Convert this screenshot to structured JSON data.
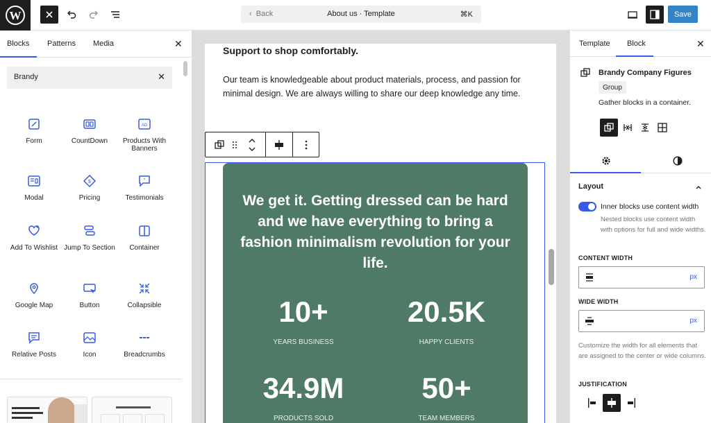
{
  "topbar": {
    "wp_logo_icon": "wordpress-logo",
    "back_label": "Back",
    "doc_title": "About us · Template",
    "shortcut": "⌘K",
    "save_label": "Save"
  },
  "inserter": {
    "tabs": [
      "Blocks",
      "Patterns",
      "Media"
    ],
    "active_tab": "Blocks",
    "search_value": "Brandy",
    "blocks": [
      {
        "label": "Form",
        "icon": "form-icon"
      },
      {
        "label": "CountDown",
        "icon": "countdown-icon"
      },
      {
        "label": "Products With Banners",
        "icon": "products-banner-icon"
      },
      {
        "label": "Modal",
        "icon": "modal-icon"
      },
      {
        "label": "Pricing",
        "icon": "pricing-icon"
      },
      {
        "label": "Testimonials",
        "icon": "testimonials-icon"
      },
      {
        "label": "Add To Wishlist",
        "icon": "wishlist-icon"
      },
      {
        "label": "Jump To Section",
        "icon": "jump-icon"
      },
      {
        "label": "Container",
        "icon": "container-icon"
      },
      {
        "label": "Google Map",
        "icon": "map-pin-icon"
      },
      {
        "label": "Button",
        "icon": "button-icon"
      },
      {
        "label": "Collapsible",
        "icon": "collapsible-icon"
      },
      {
        "label": "Relative Posts",
        "icon": "posts-icon"
      },
      {
        "label": "Icon",
        "icon": "image-icon"
      },
      {
        "label": "Breadcrumbs",
        "icon": "breadcrumbs-icon"
      }
    ]
  },
  "canvas": {
    "heading": "Support to shop comfortably.",
    "paragraph": "Our team is knowledgeable about product materials, process, and passion for minimal design. We are always willing to share our deep knowledge any time.",
    "headline": "We get it. Getting dressed can be hard and we have everything to bring a fashion minimalism revolution for your life.",
    "stats": [
      {
        "value": "10+",
        "label": "YEARS BUSINESS"
      },
      {
        "value": "20.5K",
        "label": "HAPPY CLIENTS"
      },
      {
        "value": "34.9M",
        "label": "PRODUCTS SOLD"
      },
      {
        "value": "50+",
        "label": "TEAM MEMBERS"
      }
    ],
    "accent_color": "#4f7a66"
  },
  "settings": {
    "tabs": [
      "Template",
      "Block"
    ],
    "active_tab": "Block",
    "block_title": "Brandy Company Figures",
    "block_type": "Group",
    "block_desc": "Gather blocks in a container.",
    "section_layout": "Layout",
    "toggle_label": "Inner blocks use content width",
    "toggle_on": true,
    "toggle_help": "Nested blocks use content width with options for full and wide widths.",
    "content_width_label": "CONTENT WIDTH",
    "content_width_unit": "px",
    "wide_width_label": "WIDE WIDTH",
    "wide_width_unit": "px",
    "width_help": "Customize the width for all elements that are assigned to the center or wide columns.",
    "justification_label": "JUSTIFICATION",
    "accent": "#3858e9"
  }
}
